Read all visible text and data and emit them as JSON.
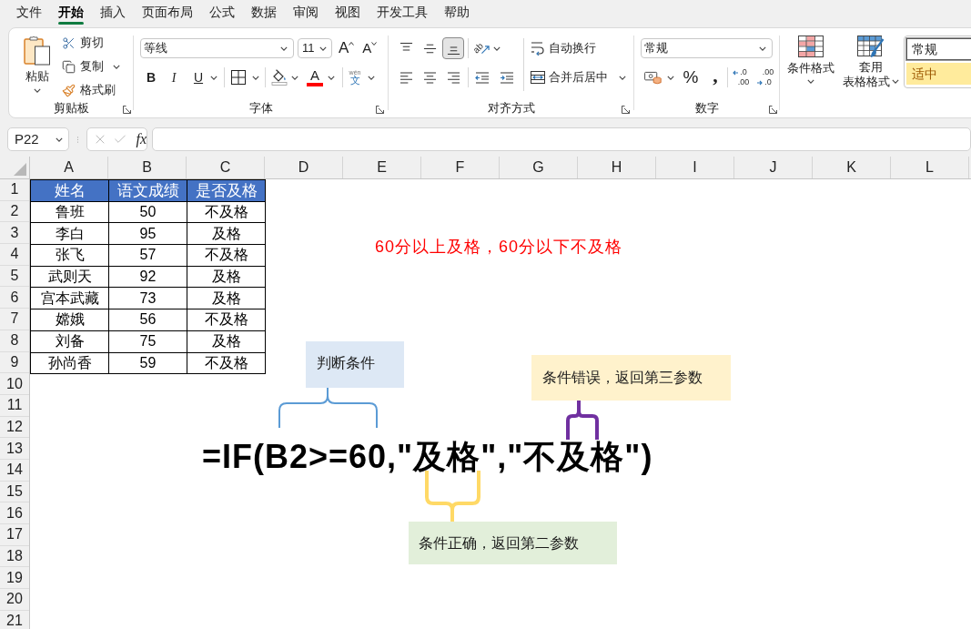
{
  "menu_tabs": [
    {
      "label": "文件",
      "selected": false
    },
    {
      "label": "开始",
      "selected": true
    },
    {
      "label": "插入",
      "selected": false
    },
    {
      "label": "页面布局",
      "selected": false
    },
    {
      "label": "公式",
      "selected": false
    },
    {
      "label": "数据",
      "selected": false
    },
    {
      "label": "审阅",
      "selected": false
    },
    {
      "label": "视图",
      "selected": false
    },
    {
      "label": "开发工具",
      "selected": false
    },
    {
      "label": "帮助",
      "selected": false
    }
  ],
  "ribbon": {
    "clipboard": {
      "paste": "粘贴",
      "cut": "剪切",
      "copy": "复制",
      "format_painter": "格式刷",
      "group_label": "剪贴板"
    },
    "font": {
      "font_name": "等线",
      "font_size": "11",
      "grow_font": "A",
      "shrink_font": "A",
      "bold": "B",
      "italic": "I",
      "underline": "U",
      "font_color": "A",
      "phonetic": {
        "ruby": "wén",
        "character": "文"
      },
      "group_label": "字体"
    },
    "alignment": {
      "vertical": [
        {
          "kind": "top",
          "selected": false
        },
        {
          "kind": "middle",
          "selected": false
        },
        {
          "kind": "bottom",
          "selected": true
        }
      ],
      "orientation": "ab",
      "horizontal": [
        {
          "kind": "left",
          "selected": false
        },
        {
          "kind": "center",
          "selected": false
        },
        {
          "kind": "right",
          "selected": false
        }
      ],
      "wrap_text": "自动换行",
      "merge_center": "合并后居中",
      "group_label": "对齐方式"
    },
    "number": {
      "format": "常规",
      "percent": "%",
      "comma": ",",
      "increase_decimal": {
        "top": ".0",
        "bottom": ".00"
      },
      "decrease_decimal": {
        "top": ".00",
        "bottom": ".0"
      },
      "group_label": "数字"
    },
    "styles": {
      "conditional_formatting": "条件格式",
      "format_as_table": [
        "套用",
        "表格格式"
      ],
      "gallery": [
        {
          "label": "常规",
          "kind": "normal",
          "selected": true
        },
        {
          "label": "适中",
          "kind": "neutral",
          "selected": false
        }
      ]
    }
  },
  "formula_bar": {
    "name_box": "P22",
    "function_label": "fx"
  },
  "sheet": {
    "columns": [
      "A",
      "B",
      "C",
      "D",
      "E",
      "F",
      "G",
      "H",
      "I",
      "J",
      "K",
      "L"
    ],
    "rows": [
      "1",
      "2",
      "3",
      "4",
      "5",
      "6",
      "7",
      "8",
      "9",
      "10",
      "11",
      "12",
      "13",
      "14",
      "15",
      "16",
      "17",
      "18",
      "19",
      "20",
      "21"
    ],
    "table": {
      "header": [
        "姓名",
        "语文成绩",
        "是否及格"
      ],
      "rows": [
        [
          "鲁班",
          "50",
          "不及格"
        ],
        [
          "李白",
          "95",
          "及格"
        ],
        [
          "张飞",
          "57",
          "不及格"
        ],
        [
          "武则天",
          "92",
          "及格"
        ],
        [
          "宫本武藏",
          "73",
          "及格"
        ],
        [
          "嫦娥",
          "56",
          "不及格"
        ],
        [
          "刘备",
          "75",
          "及格"
        ],
        [
          "孙尚香",
          "59",
          "不及格"
        ]
      ]
    }
  },
  "annotations": {
    "note": "60分以上及格，60分以下不及格",
    "formula": "=IF(B2>=60,\"及格\",\"不及格\")",
    "callouts": [
      {
        "kind": "condition",
        "text": "判断条件"
      },
      {
        "kind": "else_value",
        "text": "条件错误，返回第三参数"
      },
      {
        "kind": "then_value",
        "text": "条件正确，返回第二参数"
      }
    ]
  }
}
